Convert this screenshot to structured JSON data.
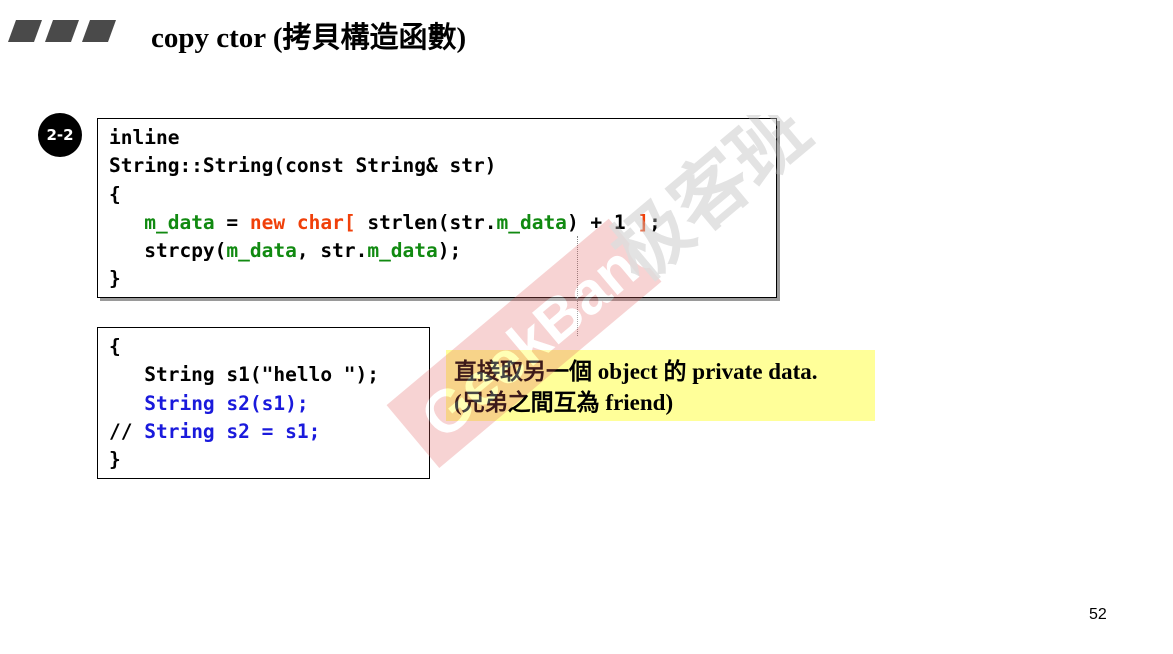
{
  "slide": {
    "title": "copy ctor (拷貝構造函數)",
    "badge": "2-2",
    "page_number": "52"
  },
  "code_box_1": {
    "line1": "inline",
    "line2": "String::String(const String& str)",
    "line3": "{",
    "line4": {
      "indent": "   ",
      "m_data": "m_data",
      "eq": " = ",
      "new_char": "new char[",
      "strlen_open": " strlen(str.",
      "m_data2": "m_data",
      "plus": ") + 1 ",
      "close": "]",
      "semi": ";"
    },
    "line5": {
      "indent": "   ",
      "strcpy": "strcpy(",
      "m_data": "m_data",
      "mid": ", str.",
      "m_data2": "m_data",
      "end": ");"
    },
    "line6": "}"
  },
  "code_box_2": {
    "line1": "{",
    "line2": "   String s1(\"hello \");",
    "line3": {
      "indent": "   ",
      "code": "String s2(s1);"
    },
    "line4": {
      "comment": "// ",
      "code": "String s2 = s1;"
    },
    "line5": "}"
  },
  "note": {
    "line1": "直接取另一個 object 的 private data.",
    "line2": "(兄弟之間互為 friend)"
  },
  "watermark": {
    "text_en": "GeekBand",
    "text_cn": "极客班"
  },
  "colors": {
    "green": "#118a11",
    "red": "#f0400a",
    "blue": "#1a1adc",
    "note_bg": "#ffff99",
    "watermark": "#e06060"
  }
}
